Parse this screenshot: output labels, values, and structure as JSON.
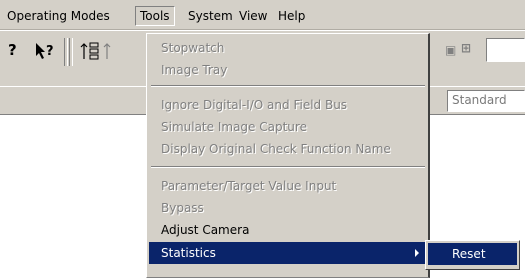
{
  "menubar": {
    "items": [
      {
        "label": "Operating Modes"
      },
      {
        "label": "Tools",
        "active": true
      },
      {
        "label": "System"
      },
      {
        "label": "View"
      },
      {
        "label": "Help"
      }
    ]
  },
  "toolbar": {
    "help_icon": "?",
    "context_help_icon": "↖?",
    "mode_combo_value": "Standard"
  },
  "tools_menu": {
    "items": [
      {
        "label": "Stopwatch",
        "enabled": false
      },
      {
        "label": "Image Tray",
        "enabled": false
      },
      {
        "label": "Ignore Digital-I/O and Field Bus",
        "enabled": false
      },
      {
        "label": "Simulate Image Capture",
        "enabled": false
      },
      {
        "label": "Display Original Check Function Name",
        "enabled": false
      },
      {
        "label": "Parameter/Target Value Input",
        "enabled": false
      },
      {
        "label": "Bypass",
        "enabled": false
      },
      {
        "label": "Adjust Camera",
        "enabled": true
      },
      {
        "label": "Statistics",
        "enabled": true,
        "selected": true,
        "has_submenu": true
      }
    ]
  },
  "statistics_submenu": {
    "items": [
      {
        "label": "Reset",
        "selected": true
      }
    ]
  },
  "colors": {
    "menu_background": "#d4d0c8",
    "selection_background": "#0a246a",
    "disabled_text": "#808080"
  }
}
